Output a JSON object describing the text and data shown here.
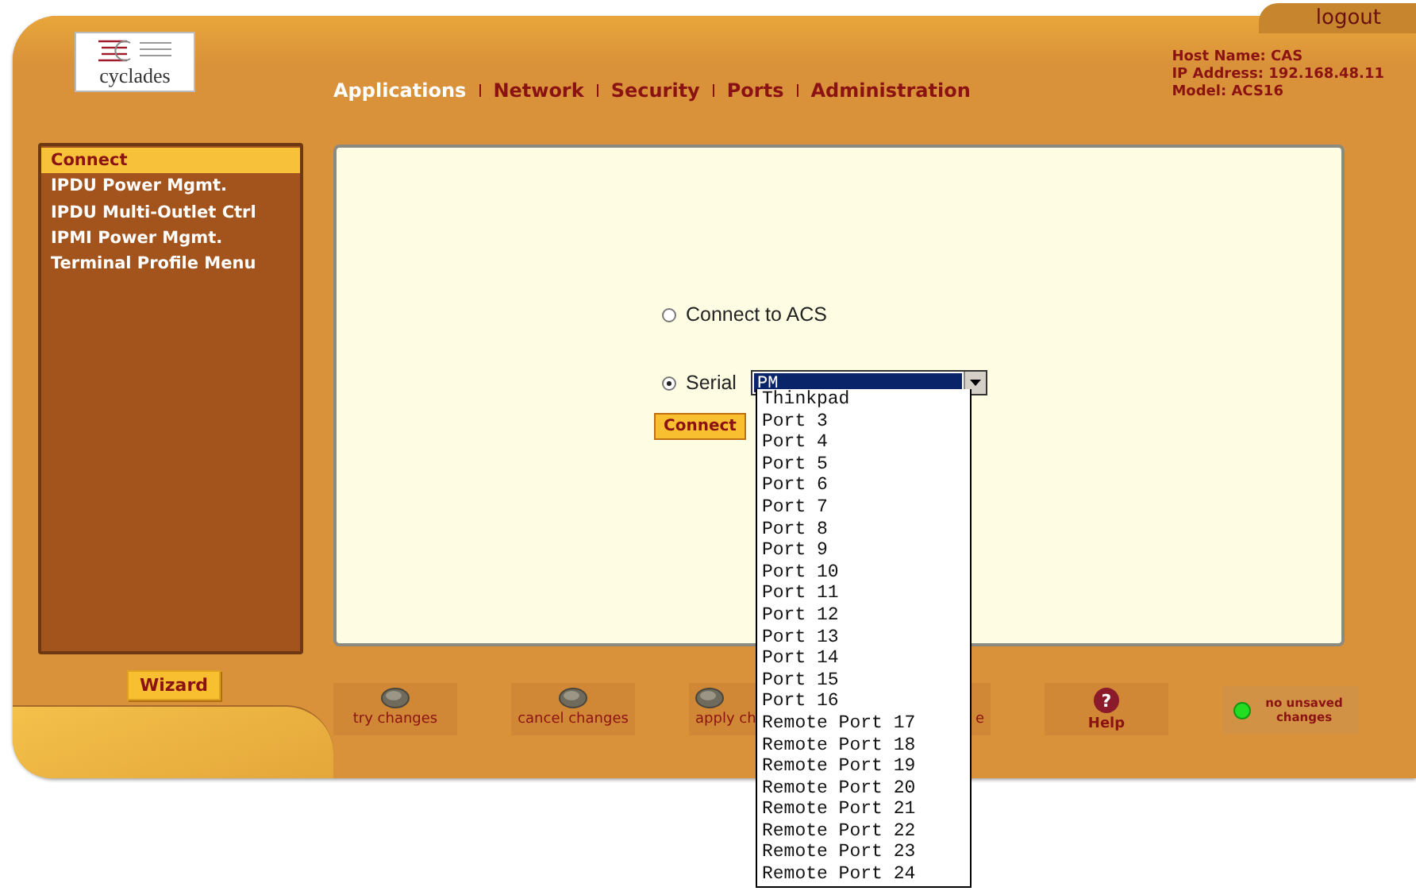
{
  "header": {
    "logo_text": "cyclades",
    "logout": "logout",
    "nav": [
      {
        "label": "Applications",
        "selected": true
      },
      {
        "label": "Network",
        "selected": false
      },
      {
        "label": "Security",
        "selected": false
      },
      {
        "label": "Ports",
        "selected": false
      },
      {
        "label": "Administration",
        "selected": false
      }
    ],
    "host_info": [
      "Host Name: CAS",
      "IP Address: 192.168.48.11",
      "Model: ACS16"
    ]
  },
  "sidebar": {
    "items": [
      {
        "label": "Connect",
        "selected": true
      },
      {
        "label": "IPDU Power Mgmt.",
        "selected": false
      },
      {
        "label": "IPDU Multi-Outlet Ctrl",
        "selected": false
      },
      {
        "label": "IPMI Power Mgmt.",
        "selected": false
      },
      {
        "label": "Terminal Profile Menu",
        "selected": false
      }
    ],
    "wizard_button": "Wizard"
  },
  "connect_form": {
    "radios": [
      {
        "label": "Connect to ACS",
        "selected": false
      },
      {
        "label": "Serial",
        "selected": true
      }
    ],
    "serial_select": {
      "value": "PM",
      "expanded": true,
      "options": [
        {
          "label": "Thinkpad",
          "selected": false
        },
        {
          "label": "Port 3",
          "selected": false
        },
        {
          "label": "Port 4",
          "selected": false
        },
        {
          "label": "Port 5",
          "selected": false
        },
        {
          "label": "Port 6",
          "selected": false
        },
        {
          "label": "Port 7",
          "selected": false
        },
        {
          "label": "Port 8",
          "selected": false
        },
        {
          "label": "Port 9",
          "selected": false
        },
        {
          "label": "Port 10",
          "selected": false
        },
        {
          "label": "Port 11",
          "selected": false
        },
        {
          "label": "Port 12",
          "selected": false
        },
        {
          "label": "Port 13",
          "selected": false
        },
        {
          "label": "Port 14",
          "selected": false
        },
        {
          "label": "Port 15",
          "selected": false
        },
        {
          "label": "Port 16",
          "selected": false
        },
        {
          "label": "Remote Port 17",
          "selected": false
        },
        {
          "label": "Remote Port 18",
          "selected": false
        },
        {
          "label": "Remote Port 19",
          "selected": false
        },
        {
          "label": "Remote Port 20",
          "selected": false
        },
        {
          "label": "Remote Port 21",
          "selected": false
        },
        {
          "label": "Remote Port 22",
          "selected": false
        },
        {
          "label": "Remote Port 23",
          "selected": false
        },
        {
          "label": "Remote Port 24",
          "selected": false
        }
      ]
    },
    "connect_button": "Connect"
  },
  "toolbar": [
    {
      "kind": "action",
      "label": "try changes"
    },
    {
      "kind": "action",
      "label": "cancel changes"
    },
    {
      "kind": "action",
      "label": "apply ch",
      "covered_right": true
    },
    {
      "kind": "action",
      "label": "e",
      "covered_left": true
    },
    {
      "kind": "help",
      "label": "Help",
      "icon": "?"
    },
    {
      "kind": "status",
      "label": "no unsaved changes"
    }
  ]
}
